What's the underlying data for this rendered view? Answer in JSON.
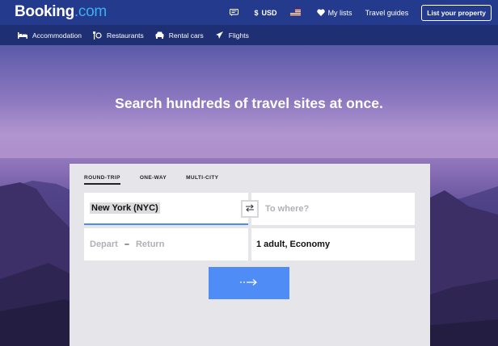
{
  "header": {
    "logo_main": "Booking",
    "logo_suffix": ".com",
    "currency": "USD",
    "my_lists": "My lists",
    "travel_guides": "Travel guides",
    "list_property": "List your property"
  },
  "nav": {
    "items": [
      {
        "label": "Accommodation",
        "icon": "bed-icon"
      },
      {
        "label": "Restaurants",
        "icon": "restaurant-icon"
      },
      {
        "label": "Rental cars",
        "icon": "car-icon"
      },
      {
        "label": "Flights",
        "icon": "plane-icon"
      }
    ]
  },
  "hero": {
    "headline": "Search hundreds of travel sites at once."
  },
  "search": {
    "trip_types": [
      "ROUND-TRIP",
      "ONE-WAY",
      "MULTI-CITY"
    ],
    "active_trip_type": "ROUND-TRIP",
    "origin": "New York (NYC)",
    "destination_placeholder": "To where?",
    "depart_placeholder": "Depart",
    "date_separator": "–",
    "return_placeholder": "Return",
    "travelers": "1 adult, Economy"
  },
  "colors": {
    "brand_blue": "#243a8c",
    "nav_blue": "#1e2f73",
    "accent_blue": "#4f8cf5",
    "panel_gray": "#e6e6ea"
  }
}
